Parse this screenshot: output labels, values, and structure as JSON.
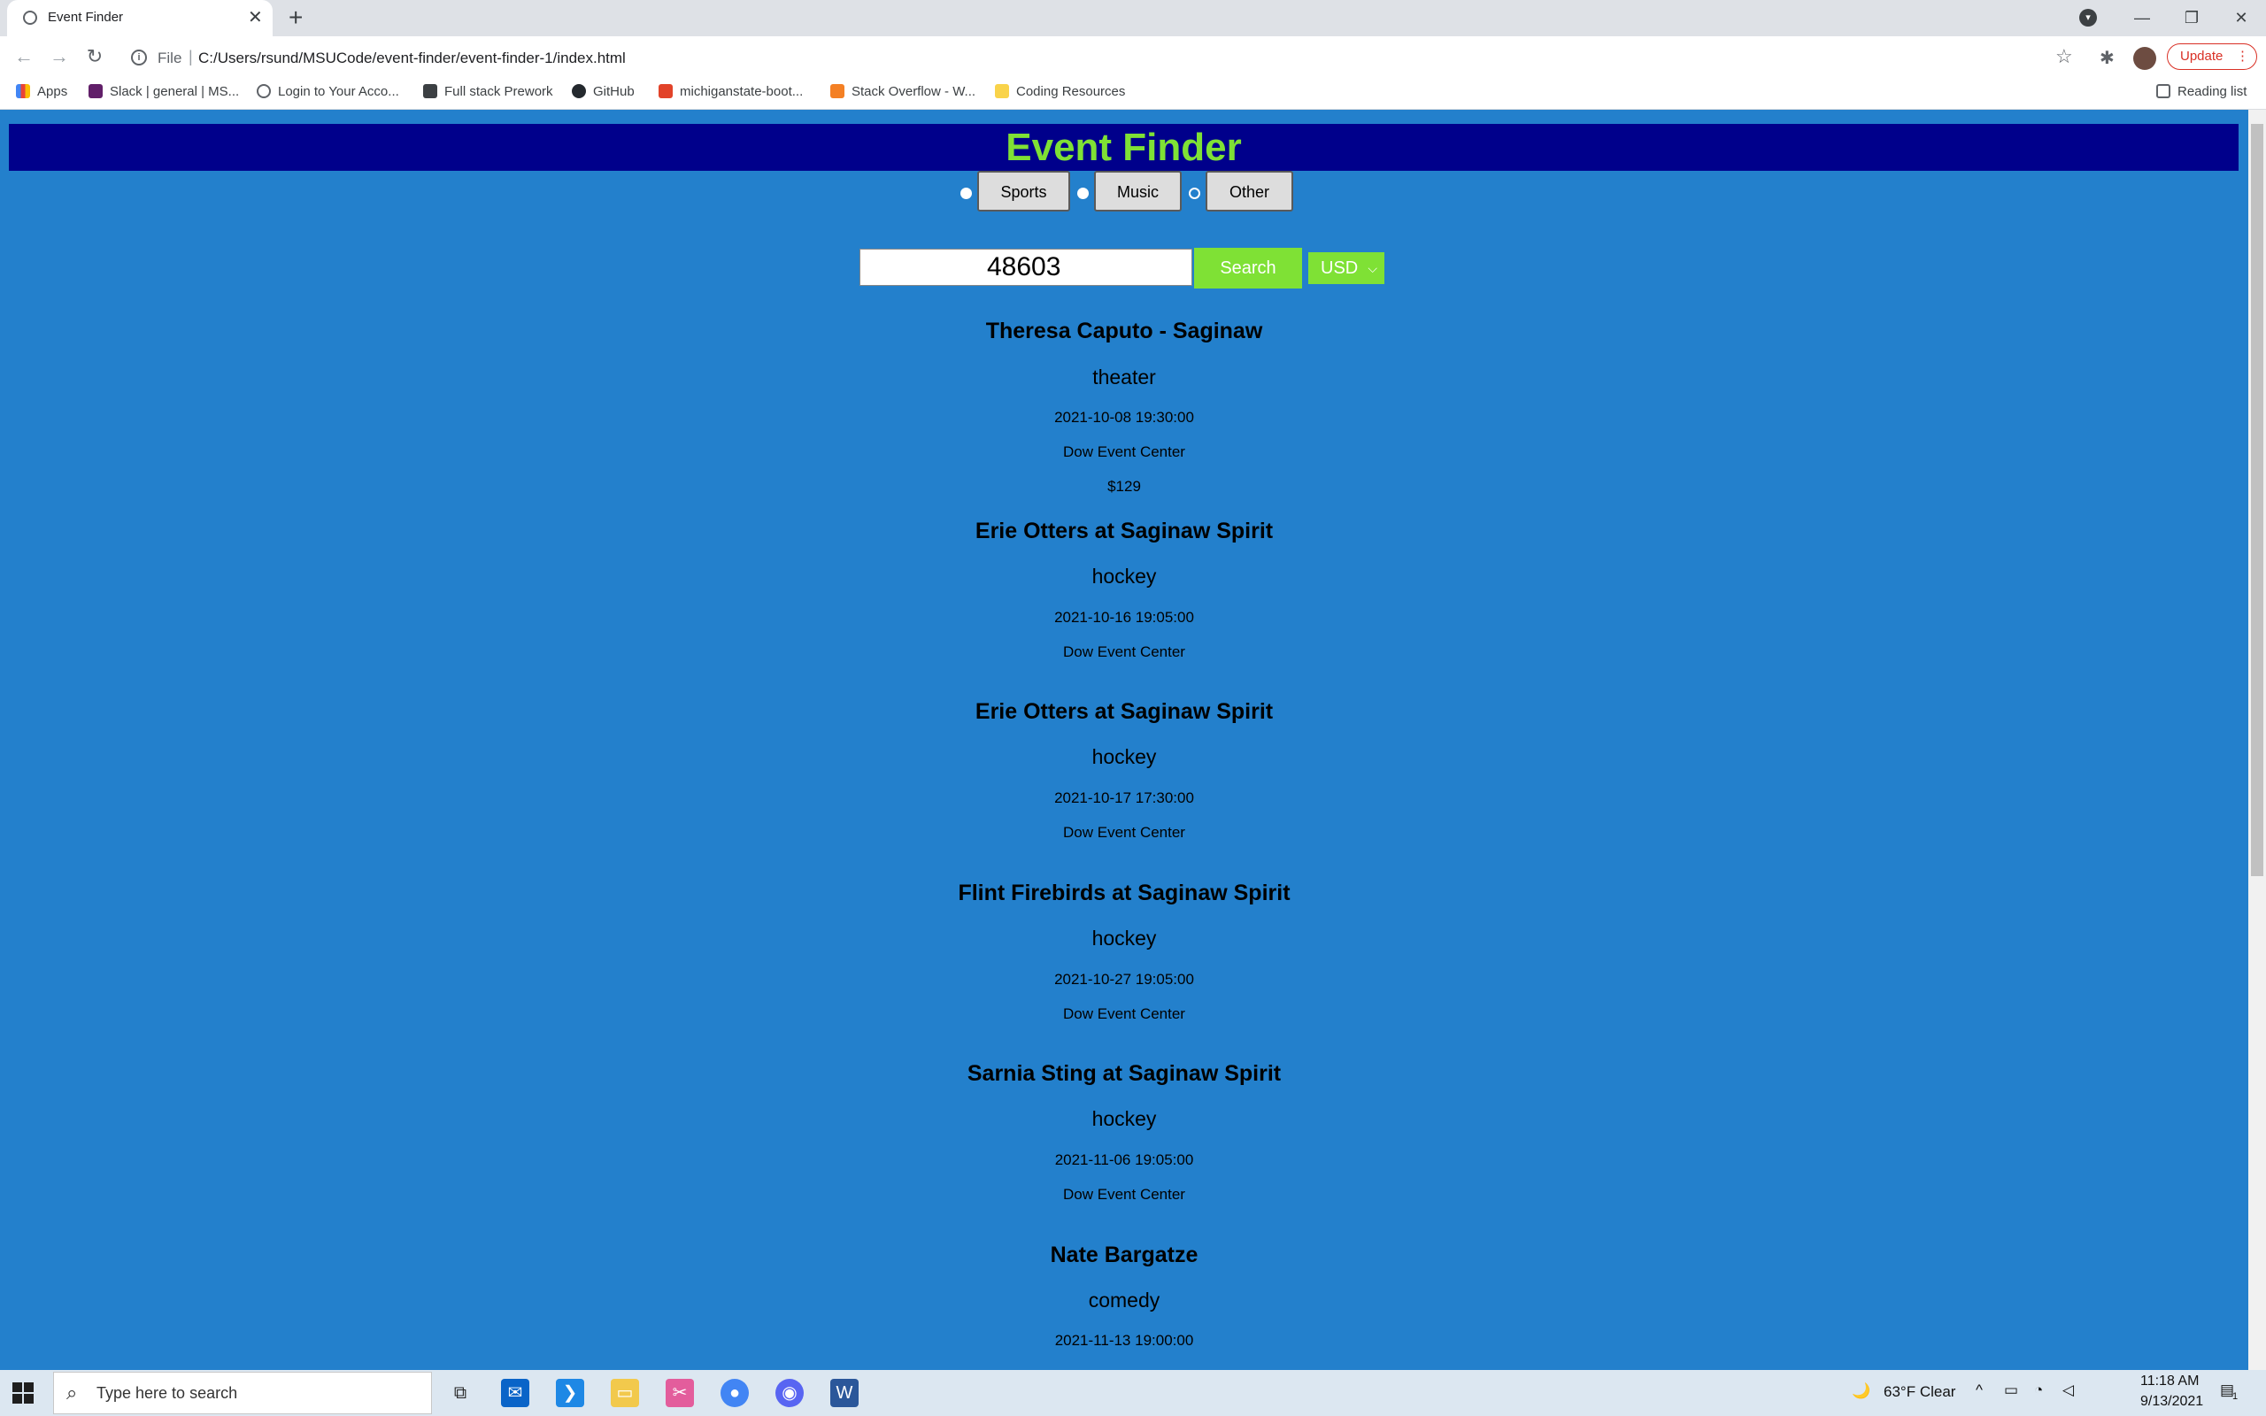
{
  "browser": {
    "tab_title": "Event Finder",
    "tab_close": "✕",
    "new_tab": "+",
    "window_controls": [
      "—",
      "❐",
      "✕"
    ],
    "tab_search": "▾",
    "address": {
      "scheme": "File",
      "url": "C:/Users/rsund/MSUCode/event-finder/event-finder-1/index.html"
    },
    "update_label": "Update",
    "update_menu": "⋮",
    "bookmarks": [
      {
        "label": "Apps",
        "icon": "apps-grid-icon",
        "color": "#e8453c"
      },
      {
        "label": "Slack | general | MS...",
        "icon": "slack-icon",
        "color": "#611f69"
      },
      {
        "label": "Login to Your Acco...",
        "icon": "globe-icon",
        "color": "#5f6368"
      },
      {
        "label": "Full stack Prework",
        "icon": "book-icon",
        "color": "#3c4043"
      },
      {
        "label": "GitHub",
        "icon": "github-icon",
        "color": "#24292e"
      },
      {
        "label": "michiganstate-boot...",
        "icon": "gitlab-icon",
        "color": "#e24329"
      },
      {
        "label": "Stack Overflow - W...",
        "icon": "stackoverflow-icon",
        "color": "#f48024"
      },
      {
        "label": "Coding Resources",
        "icon": "folder-icon",
        "color": "#f9d34a"
      }
    ],
    "reading_list": "Reading list"
  },
  "page": {
    "title": "Event Finder",
    "categories": [
      "Sports",
      "Music",
      "Other"
    ],
    "zip_value": "48603",
    "search_label": "Search",
    "currency": "USD",
    "events": [
      {
        "title": "Theresa Caputo - Saginaw",
        "type": "theater",
        "datetime": "2021-10-08 19:30:00",
        "venue": "Dow Event Center",
        "price": "$129"
      },
      {
        "title": "Erie Otters at Saginaw Spirit",
        "type": "hockey",
        "datetime": "2021-10-16 19:05:00",
        "venue": "Dow Event Center"
      },
      {
        "title": "Erie Otters at Saginaw Spirit",
        "type": "hockey",
        "datetime": "2021-10-17 17:30:00",
        "venue": "Dow Event Center"
      },
      {
        "title": "Flint Firebirds at Saginaw Spirit",
        "type": "hockey",
        "datetime": "2021-10-27 19:05:00",
        "venue": "Dow Event Center"
      },
      {
        "title": "Sarnia Sting at Saginaw Spirit",
        "type": "hockey",
        "datetime": "2021-11-06 19:05:00",
        "venue": "Dow Event Center"
      },
      {
        "title": "Nate Bargatze",
        "type": "comedy",
        "datetime": "2021-11-13 19:00:00"
      }
    ],
    "colors": {
      "background": "#2380cc",
      "banner": "#00008b",
      "accent": "#7fe135"
    }
  },
  "taskbar": {
    "search_placeholder": "Type here to search",
    "apps": [
      "task-view-icon",
      "mail-icon",
      "vscode-icon",
      "file-explorer-icon",
      "snip-icon",
      "chrome-icon",
      "discord-icon",
      "word-icon"
    ],
    "weather": "63°F  Clear",
    "time": "11:18 AM",
    "date": "9/13/2021",
    "notification_count": "1"
  }
}
